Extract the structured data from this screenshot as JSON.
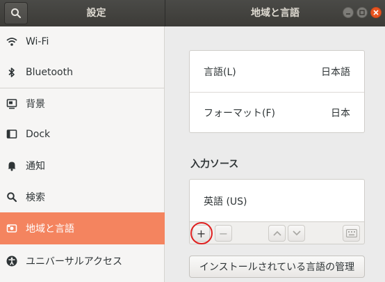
{
  "header": {
    "left_title": "設定",
    "right_title": "地域と言語",
    "search_icon": "search-icon",
    "window_controls": [
      "minimize-icon",
      "maximize-icon",
      "close-icon"
    ]
  },
  "sidebar": {
    "items": [
      {
        "label": "Wi-Fi",
        "icon": "wifi-icon"
      },
      {
        "label": "Bluetooth",
        "icon": "bluetooth-icon"
      },
      {
        "label": "背景",
        "icon": "background-icon"
      },
      {
        "label": "Dock",
        "icon": "dock-icon"
      },
      {
        "label": "通知",
        "icon": "bell-icon"
      },
      {
        "label": "検索",
        "icon": "search-icon"
      },
      {
        "label": "地域と言語",
        "icon": "region-icon",
        "active": true
      },
      {
        "label": "ユニバーサルアクセス",
        "icon": "accessibility-icon"
      }
    ]
  },
  "main": {
    "language_label": "言語(L)",
    "language_value": "日本語",
    "format_label": "フォーマット(F)",
    "format_value": "日本",
    "input_sources_title": "入力ソース",
    "input_sources": [
      "英語 (US)"
    ],
    "toolbar": {
      "add": "+",
      "remove": "−",
      "up_icon": "chevron-up-icon",
      "down_icon": "chevron-down-icon",
      "keyboard_icon": "keyboard-icon"
    },
    "manage_button": "インストールされている言語の管理"
  },
  "colors": {
    "accent": "#f4845f",
    "header": "#3c3b37",
    "close": "#e95420",
    "highlight": "#e02020"
  }
}
